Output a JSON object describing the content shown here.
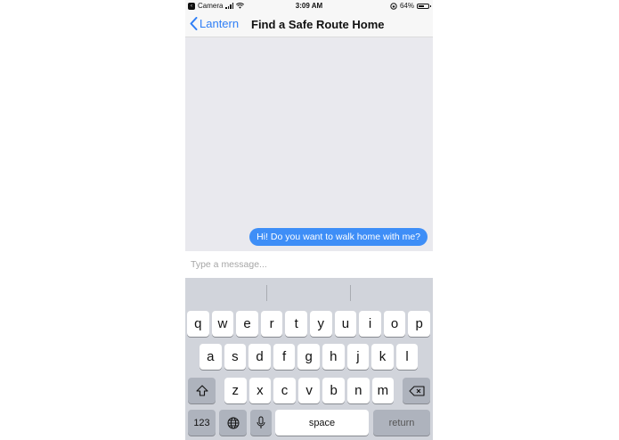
{
  "status_bar": {
    "back_app": "Camera",
    "time": "3:09 AM",
    "battery_label": "64%",
    "battery_level": 0.64
  },
  "nav": {
    "back_label": "Lantern",
    "title": "Find a Safe Route Home"
  },
  "chat": {
    "messages": [
      {
        "text": "Hi! Do you want to walk home with me?",
        "sender": "me"
      }
    ]
  },
  "composer": {
    "placeholder": "Type a message..."
  },
  "keyboard": {
    "row1": [
      "q",
      "w",
      "e",
      "r",
      "t",
      "y",
      "u",
      "i",
      "o",
      "p"
    ],
    "row2": [
      "a",
      "s",
      "d",
      "f",
      "g",
      "h",
      "j",
      "k",
      "l"
    ],
    "row3": [
      "z",
      "x",
      "c",
      "v",
      "b",
      "n",
      "m"
    ],
    "numbers_label": "123",
    "space_label": "space",
    "return_label": "return"
  },
  "colors": {
    "accent": "#2f7ff6",
    "bubble": "#3e8ef7",
    "chat_background": "#e9e9ee",
    "keyboard_background": "#d1d4db"
  }
}
